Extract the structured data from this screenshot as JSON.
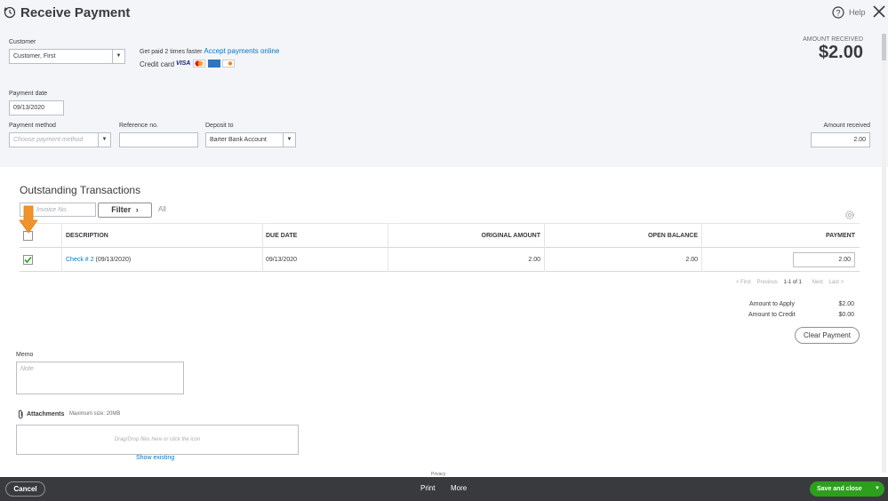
{
  "header": {
    "title": "Receive Payment",
    "help_label": "Help"
  },
  "customer": {
    "label": "Customer",
    "value": "Customer, First",
    "promo_text": "Get paid 2 times faster",
    "promo_link": "Accept payments online",
    "credit_card_label": "Credit card",
    "visa_label": "VISA"
  },
  "amount_received_banner": {
    "label": "AMOUNT RECEIVED",
    "value": "$2.00"
  },
  "payment_date": {
    "label": "Payment date",
    "value": "09/13/2020"
  },
  "payment_method": {
    "label": "Payment method",
    "placeholder": "Choose payment method"
  },
  "reference": {
    "label": "Reference no.",
    "value": ""
  },
  "deposit_to": {
    "label": "Deposit to",
    "value": "Barter Bank Account"
  },
  "amount_received_field": {
    "label": "Amount received",
    "value": "2.00"
  },
  "outstanding": {
    "title": "Outstanding Transactions",
    "search_placeholder": "Invoice No.",
    "filter_label": "Filter",
    "all_label": "All",
    "columns": [
      "DESCRIPTION",
      "DUE DATE",
      "ORIGINAL AMOUNT",
      "OPEN BALANCE",
      "PAYMENT"
    ],
    "rows": [
      {
        "checked": true,
        "description_link": "Check # 2",
        "description_rest": "(09/13/2020)",
        "due_date": "09/13/2020",
        "original_amount": "2.00",
        "open_balance": "2.00",
        "payment": "2.00"
      }
    ],
    "pagination": {
      "first": "< First",
      "previous": "Previous",
      "range": "1-1 of 1",
      "next": "Next",
      "last": "Last >"
    }
  },
  "totals": {
    "apply_label": "Amount to Apply",
    "apply_value": "$2.00",
    "credit_label": "Amount to Credit",
    "credit_value": "$0.00",
    "clear_label": "Clear Payment"
  },
  "memo": {
    "label": "Memo",
    "placeholder": "Note"
  },
  "attachments": {
    "label": "Attachments",
    "max_size": "Maximum size: 20MB",
    "drop_text": "Drag/Drop files here or click the icon",
    "show_existing": "Show existing"
  },
  "footer": {
    "cancel_label": "Cancel",
    "privacy_label": "Privacy",
    "print_label": "Print",
    "more_label": "More",
    "save_label": "Save and close"
  },
  "colors": {
    "accent_green": "#2ca01c",
    "link_blue": "#0077c5",
    "arrow_orange": "#f0932b",
    "footer_dark": "#393a3d"
  }
}
